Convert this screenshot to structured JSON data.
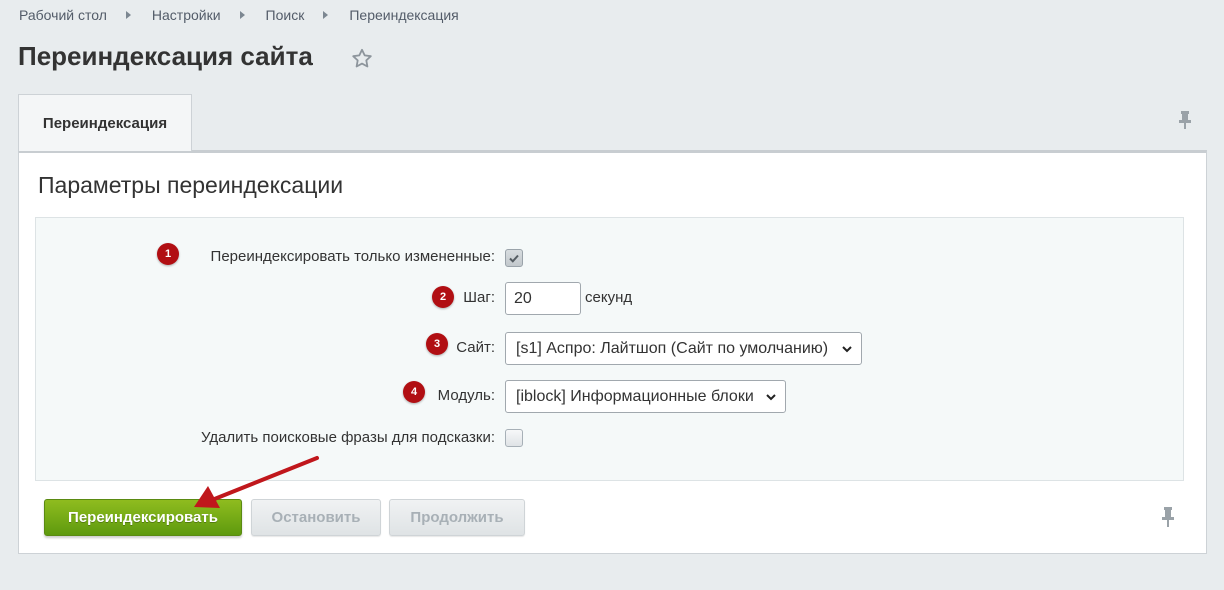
{
  "breadcrumb": [
    "Рабочий стол",
    "Настройки",
    "Поиск",
    "Переиндексация"
  ],
  "page_title": "Переиндексация сайта",
  "tab_label": "Переиндексация",
  "section_title": "Параметры переиндексации",
  "fields": {
    "only_changed_label": "Переиндексировать только измененные:",
    "only_changed_checked": true,
    "step_label": "Шаг:",
    "step_value": "20",
    "step_unit": "секунд",
    "site_label": "Сайт:",
    "site_value": "[s1] Аспро: Лайтшоп (Сайт по умолчанию)",
    "module_label": "Модуль:",
    "module_value": "[iblock] Информационные блоки",
    "delete_phrases_label": "Удалить поисковые фразы для подсказки:",
    "delete_phrases_checked": false
  },
  "badges": [
    "1",
    "2",
    "3",
    "4"
  ],
  "buttons": {
    "reindex": "Переиндексировать",
    "stop": "Остановить",
    "continue": "Продолжить"
  },
  "colors": {
    "badge": "#b10f13",
    "primary_button": "#7aad17",
    "arrow": "#c0171c"
  },
  "icons": [
    "star-icon",
    "pin-icon",
    "chevron-down-icon",
    "checkmark-icon",
    "arrow-annotation"
  ]
}
